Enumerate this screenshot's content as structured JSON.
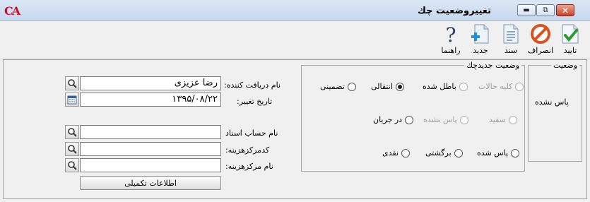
{
  "window": {
    "logo": "CA",
    "title": "تغییروضعیت چك",
    "buttons": {
      "minimize": "▬",
      "restore": "⧉",
      "close": "✕"
    }
  },
  "toolbar": {
    "confirm": "تایید",
    "cancel": "انصراف",
    "document": "سند",
    "new": "جدید",
    "help": "راهنما"
  },
  "status": {
    "legend": "وضعیت",
    "value": "پاس نشده"
  },
  "new_status": {
    "legend": "وضعیت جدیدچك",
    "options": {
      "all_states": "كلیه حالات",
      "voided": "باطل شده",
      "transferred": "انتقالی",
      "guarantee": "تضمینی",
      "blank": "سفید",
      "not_cleared": "پاس نشده",
      "in_progress": "در جریان",
      "cleared": "پاس شده",
      "returned": "برگشتی",
      "cash": "نقدی"
    },
    "selected": "transferred"
  },
  "form": {
    "receiver_label": "نام دریافت کننده:",
    "receiver_value": "رضا عزیزی",
    "date_label": "تاریخ تغییر:",
    "date_value": "۱۳۹۵/۰۸/۲۲",
    "doc_account_label": "نام حساب اسناد",
    "doc_account_value": "",
    "cost_center_code_label": "كدمركزهزینه:",
    "cost_center_code_value": "",
    "cost_center_name_label": "نام مركزهزینه:",
    "cost_center_name_value": "",
    "more_info_button": "اطلاعات تكمیلی"
  },
  "colors": {
    "confirm_check": "#2e9a2e",
    "cancel_red": "#d9531e",
    "new_plus": "#1f8fd8",
    "titlebar": "#c7d9ee"
  }
}
